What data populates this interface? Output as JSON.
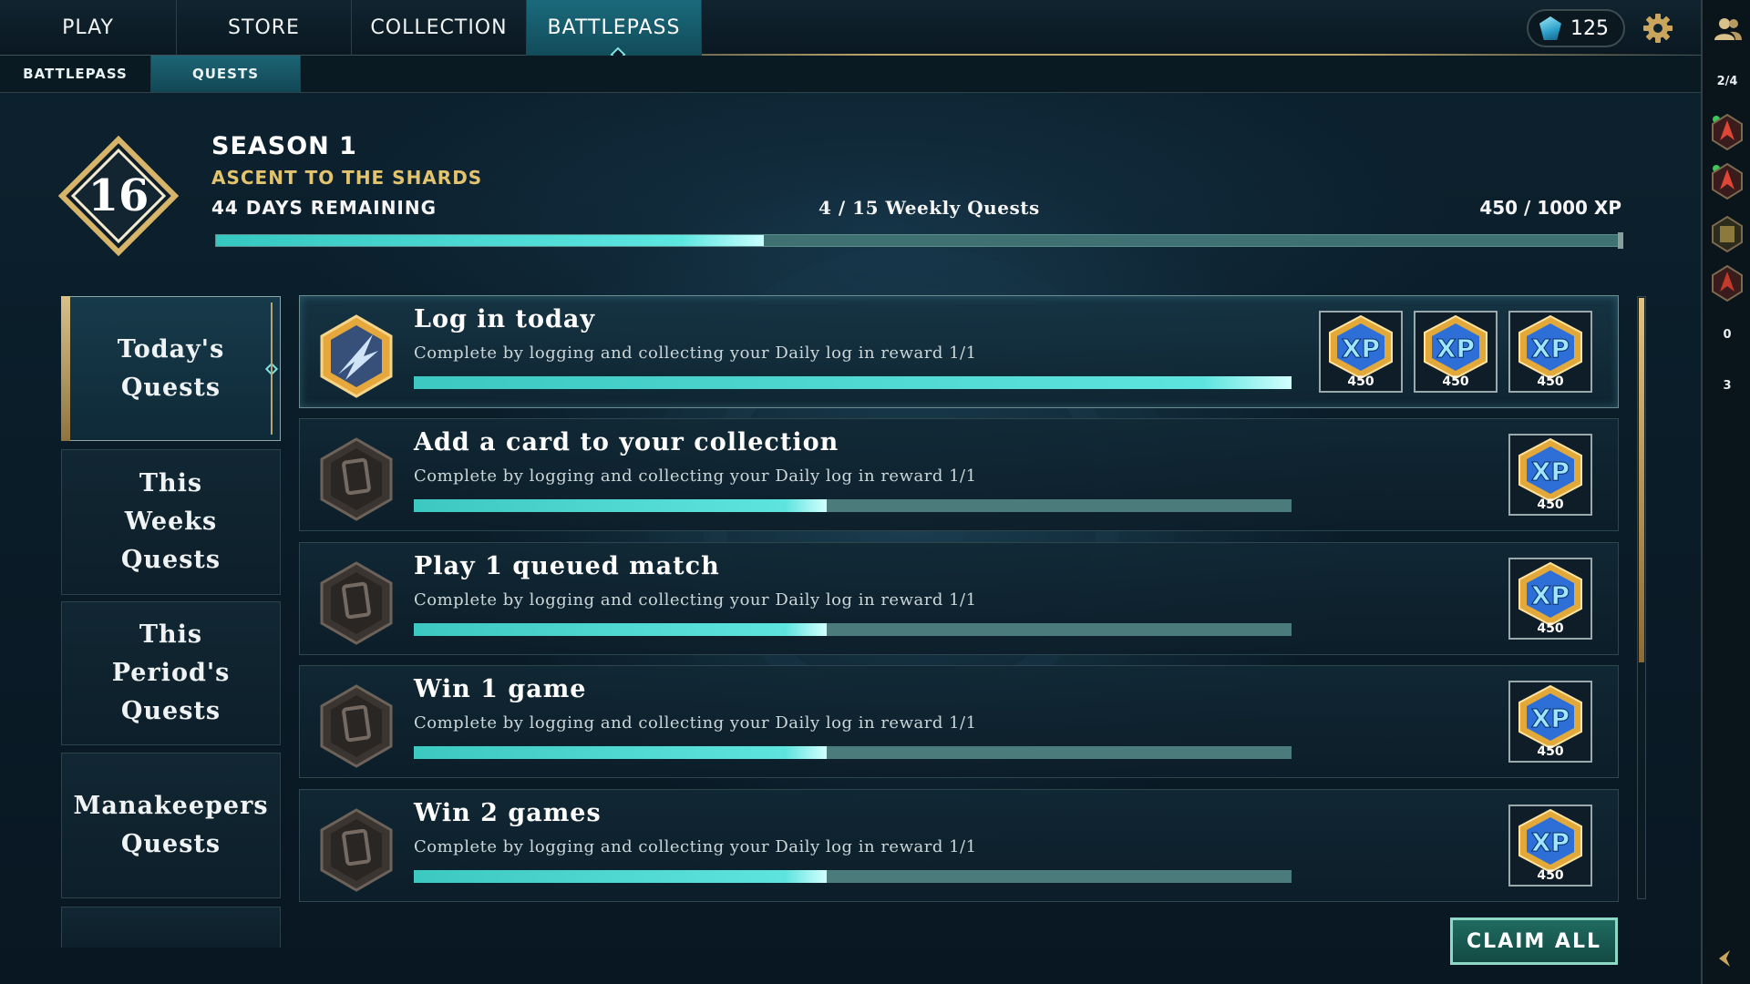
{
  "nav": {
    "tabs": [
      {
        "label": "PLAY"
      },
      {
        "label": "STORE"
      },
      {
        "label": "COLLECTION"
      },
      {
        "label": "BATTLEPASS"
      }
    ],
    "currency": "125",
    "active_tab": "BATTLEPASS"
  },
  "subnav": {
    "tabs": [
      {
        "label": "BATTLEPASS"
      },
      {
        "label": "QUESTS"
      }
    ],
    "active_tab": "QUESTS"
  },
  "season": {
    "level": "16",
    "title": "SEASON 1",
    "subtitle": "ASCENT TO THE SHARDS",
    "days_remaining": "44 DAYS REMAINING",
    "weekly_quests": "4 / 15 Weekly Quests",
    "xp": "450 / 1000 XP",
    "progress": 0.39
  },
  "categories": [
    {
      "label": "Today's\nQuests",
      "active": true
    },
    {
      "label": "This\nWeeks\nQuests",
      "active": false
    },
    {
      "label": "This\nPeriod's\nQuests",
      "active": false
    },
    {
      "label": "Manakeepers\nQuests",
      "active": false
    }
  ],
  "quests": [
    {
      "title": "Log in today",
      "description": "Complete by logging and collecting your Daily log in reward  1/1",
      "progress": 1.0,
      "rewards": [
        "450",
        "450",
        "450"
      ],
      "active": true,
      "icon": "completed-quest-icon"
    },
    {
      "title": "Add a card to your collection",
      "description": "Complete by logging and collecting your Daily log in reward  1/1",
      "progress": 0.47,
      "rewards": [
        "450"
      ],
      "active": false,
      "icon": "card-quest-icon"
    },
    {
      "title": "Play 1 queued match",
      "description": "Complete by logging and collecting your Daily log in reward  1/1",
      "progress": 0.47,
      "rewards": [
        "450"
      ],
      "active": false,
      "icon": "card-quest-icon"
    },
    {
      "title": "Win 1 game",
      "description": "Complete by logging and collecting your Daily log in reward  1/1",
      "progress": 0.47,
      "rewards": [
        "450"
      ],
      "active": false,
      "icon": "card-quest-icon"
    },
    {
      "title": "Win 2 games",
      "description": "Complete by logging and collecting your Daily log in reward  1/1",
      "progress": 0.47,
      "rewards": [
        "450"
      ],
      "active": false,
      "icon": "card-quest-icon"
    }
  ],
  "claim_all": "CLAIM ALL",
  "sidebar": {
    "party": "2/4",
    "counts": [
      "0",
      "3"
    ]
  },
  "colors": {
    "accent": "#5ee4de",
    "gold": "#e2c36e",
    "background": "#0b1a24"
  }
}
